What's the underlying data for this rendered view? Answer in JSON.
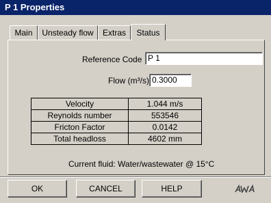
{
  "window": {
    "title": "P 1 Properties"
  },
  "tabs": [
    {
      "label": "Main"
    },
    {
      "label": "Unsteady flow"
    },
    {
      "label": "Extras"
    },
    {
      "label": "Status"
    }
  ],
  "active_tab": "Status",
  "form": {
    "reference_code_label": "Reference Code",
    "reference_code_value": "P 1",
    "flow_label": "Flow (m³/s)",
    "flow_value": "0.3000"
  },
  "stats": [
    {
      "name": "Velocity",
      "value": "1.044 m/s"
    },
    {
      "name": "Reynolds number",
      "value": "553546"
    },
    {
      "name": "Fricton Factor",
      "value": "0.0142"
    },
    {
      "name": "Total headloss",
      "value": "4602 mm"
    }
  ],
  "fluid": {
    "text": "Current fluid:  Water/wastewater @ 15°C"
  },
  "buttons": {
    "ok": "OK",
    "cancel": "CANCEL",
    "help": "HELP"
  },
  "logo_text": "AWA"
}
